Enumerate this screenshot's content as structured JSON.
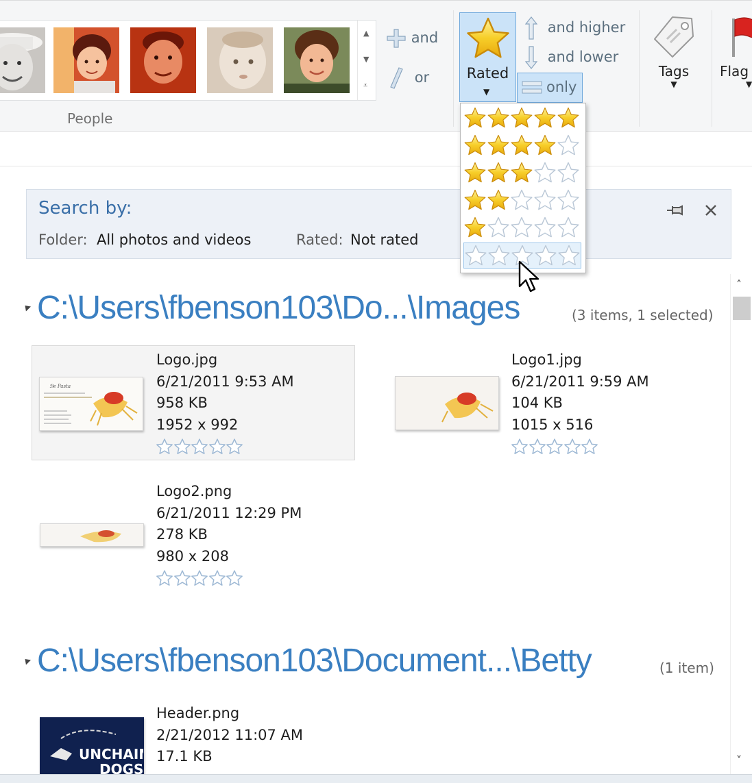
{
  "ribbon": {
    "people_group_label": "People",
    "and_label": "and",
    "or_label": "or",
    "and_higher_label": "and higher",
    "and_lower_label": "and lower",
    "only_label": "only",
    "rated_label": "Rated",
    "tags_label": "Tags",
    "flag_label": "Flag"
  },
  "rating_menu": {
    "options": [
      {
        "rating": 5
      },
      {
        "rating": 4
      },
      {
        "rating": 3
      },
      {
        "rating": 2
      },
      {
        "rating": 1
      },
      {
        "rating": 0
      }
    ],
    "hovered_rating": 0
  },
  "search": {
    "title": "Search by:",
    "folder_label": "Folder:",
    "folder_value": "All photos and videos",
    "rated_label": "Rated:",
    "rated_value": "Not rated"
  },
  "groups": [
    {
      "path": "C:\\Users\\fbenson103\\Do...\\Images",
      "count": "(3 items, 1 selected)",
      "items": [
        {
          "name": "Logo.jpg",
          "date": "6/21/2011 9:53 AM",
          "size": "958 KB",
          "dimensions": "1952 x 992",
          "rating": 0,
          "selected": true
        },
        {
          "name": "Logo1.jpg",
          "date": "6/21/2011 9:59 AM",
          "size": "104 KB",
          "dimensions": "1015 x 516",
          "rating": 0,
          "selected": false
        },
        {
          "name": "Logo2.png",
          "date": "6/21/2011 12:29 PM",
          "size": "278 KB",
          "dimensions": "980 x 208",
          "rating": 0,
          "selected": false
        }
      ]
    },
    {
      "path": "C:\\Users\\fbenson103\\Document...\\Betty",
      "count": "(1 item)",
      "items": [
        {
          "name": "Header.png",
          "date": "2/21/2012 11:07 AM",
          "size": "17.1 KB",
          "thumb_text": "UNCHAIN DOGS"
        }
      ]
    }
  ],
  "colors": {
    "accent": "#3a7fc1",
    "selection": "#cbe3f8",
    "star_fill": "#f5c518"
  }
}
